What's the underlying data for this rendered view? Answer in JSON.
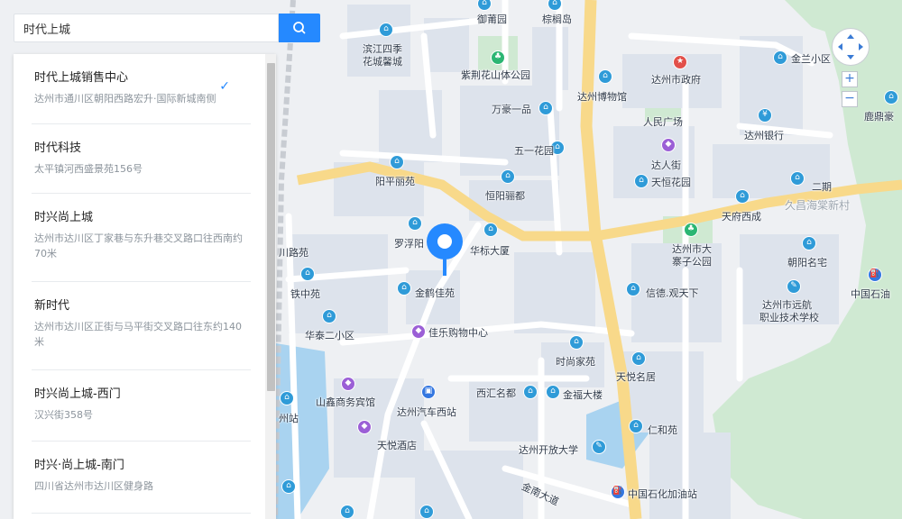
{
  "search": {
    "value": "时代上城",
    "button_icon": "search-icon"
  },
  "results": [
    {
      "name": "时代上城销售中心",
      "address": "达州市通川区朝阳西路宏升·国际新城南侧",
      "selected": true
    },
    {
      "name": "时代科技",
      "address": "太平镇河西盛景苑156号"
    },
    {
      "name": "时兴尚上城",
      "address": "达州市达川区丁家巷与东升巷交叉路口往西南约70米"
    },
    {
      "name": "新时代",
      "address": "达州市达川区正街与马平街交叉路口往东约140米"
    },
    {
      "name": "时兴尚上城-西门",
      "address": "汉兴街358号"
    },
    {
      "name": "时兴·尚上城-南门",
      "address": "四川省达州市达川区健身路"
    }
  ],
  "map": {
    "labels": {
      "yupu": "御莆园",
      "zonglv": "棕榈岛",
      "binjiang": "滨江四季",
      "huacheng": "花城馨城",
      "zijing": "紫荆花山体公园",
      "bowuguan": "达州博物馆",
      "shizhengfu": "达州市政府",
      "jinlan": "金兰小区",
      "lujing": "鹿鼎豪",
      "wanhao": "万豪一品",
      "renmin": "人民广场",
      "bank": "达州银行",
      "wuyi": "五一花园",
      "darenjie": "达人街",
      "tianheng": "天恒花园",
      "erqi": "二期",
      "jiuchang": "久昌海棠新村",
      "yangping": "阳平丽苑",
      "hengyang": "恒阳骊都",
      "tianfu": "天府西成",
      "luofu": "罗浮阳",
      "huabiao": "华标大厦",
      "dazhai": "达州市大",
      "zhaizi": "寨子公园",
      "chaoyang": "朝阳名宅",
      "sinopec_r": "中国石油",
      "lujiayuan": "川路苑",
      "tiezhong": "铁中苑",
      "jinhe": "金鹤佳苑",
      "xinde": "信德.观天下",
      "yuanhang": "达州市远航",
      "zhiye": "职业技术学校",
      "huatai": "华泰二小区",
      "jiale": "佳乐购物中心",
      "shishang": "时尚家苑",
      "tianyue_m": "天悦名居",
      "shanxin": "山鑫商务宾馆",
      "xihui": "西汇名都",
      "jinfu": "金福大楼",
      "zhou": "州站",
      "bus": "达州汽车西站",
      "renhe": "仁和苑",
      "tianyue_h": "天悦酒店",
      "kaifang": "达州开放大学",
      "jinnan": "金南大道",
      "sinopec": "中国石化加油站"
    }
  },
  "zoom": {
    "in": "+",
    "out": "−"
  }
}
